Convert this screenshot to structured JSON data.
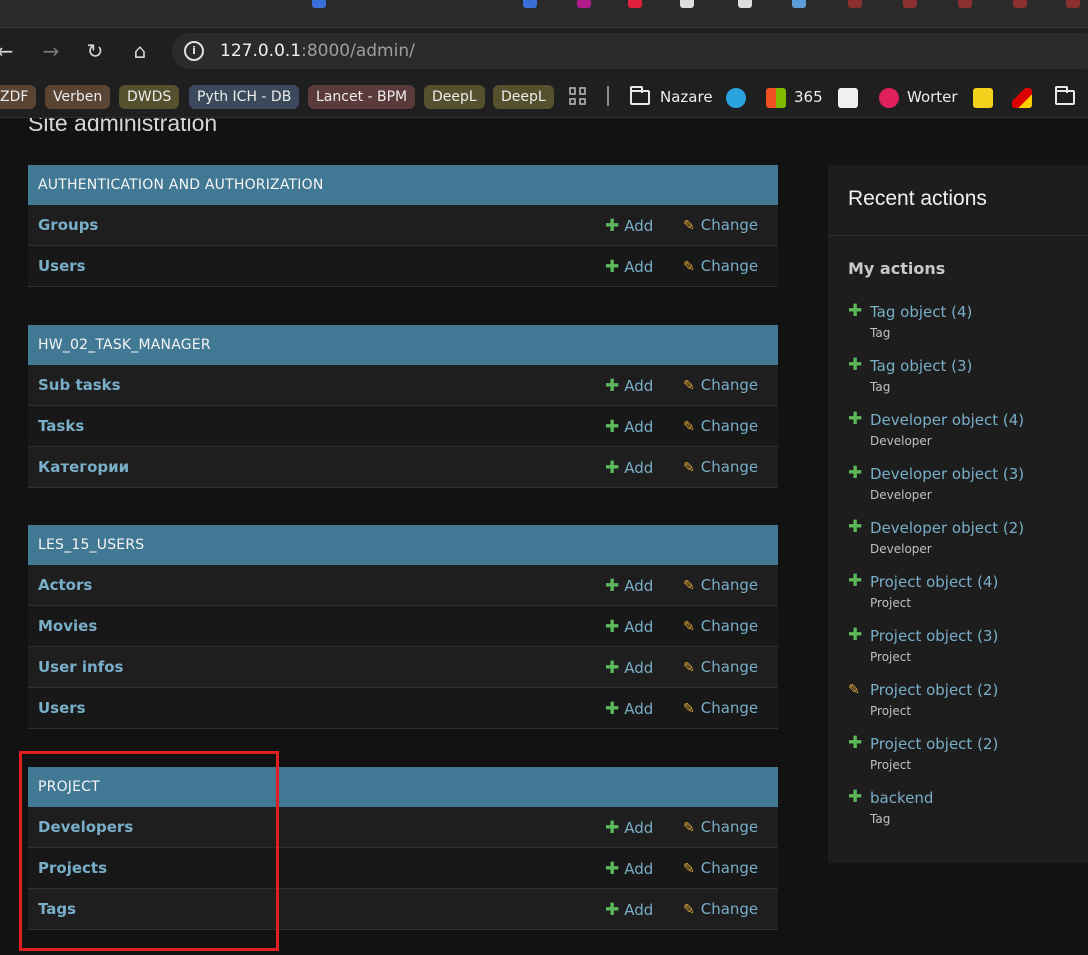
{
  "browser": {
    "url_host": "127.0.0.1",
    "url_rest": ":8000/admin/",
    "bookmarks": [
      {
        "label": "ZDF",
        "color": "#5a4535"
      },
      {
        "label": "Verben",
        "color": "#5a4535"
      },
      {
        "label": "DWDS",
        "color": "#55502e"
      },
      {
        "label": "Pyth ICH - DB",
        "color": "#3a4a5a"
      },
      {
        "label": "Lancet - BPM",
        "color": "#5a3a3a"
      },
      {
        "label": "DeepL",
        "color": "#55502e"
      },
      {
        "label": "DeepL",
        "color": "#55502e"
      }
    ],
    "bookmark_folders": [
      "Nazare",
      "365",
      "Worter"
    ]
  },
  "page": {
    "title": "Site administration"
  },
  "modules": [
    {
      "caption": "AUTHENTICATION AND AUTHORIZATION",
      "rows": [
        {
          "name": "Groups",
          "add": "Add",
          "change": "Change"
        },
        {
          "name": "Users",
          "add": "Add",
          "change": "Change"
        }
      ]
    },
    {
      "caption": "HW_02_TASK_MANAGER",
      "rows": [
        {
          "name": "Sub tasks",
          "add": "Add",
          "change": "Change"
        },
        {
          "name": "Tasks",
          "add": "Add",
          "change": "Change"
        },
        {
          "name": "Категории",
          "add": "Add",
          "change": "Change"
        }
      ]
    },
    {
      "caption": "LES_15_USERS",
      "rows": [
        {
          "name": "Actors",
          "add": "Add",
          "change": "Change"
        },
        {
          "name": "Movies",
          "add": "Add",
          "change": "Change"
        },
        {
          "name": "User infos",
          "add": "Add",
          "change": "Change"
        },
        {
          "name": "Users",
          "add": "Add",
          "change": "Change"
        }
      ]
    },
    {
      "caption": "PROJECT",
      "rows": [
        {
          "name": "Developers",
          "add": "Add",
          "change": "Change"
        },
        {
          "name": "Projects",
          "add": "Add",
          "change": "Change"
        },
        {
          "name": "Tags",
          "add": "Add",
          "change": "Change"
        }
      ]
    }
  ],
  "recent": {
    "title": "Recent actions",
    "subtitle": "My actions",
    "actions": [
      {
        "icon": "add",
        "label": "Tag object (4)",
        "type": "Tag"
      },
      {
        "icon": "add",
        "label": "Tag object (3)",
        "type": "Tag"
      },
      {
        "icon": "add",
        "label": "Developer object (4)",
        "type": "Developer"
      },
      {
        "icon": "add",
        "label": "Developer object (3)",
        "type": "Developer"
      },
      {
        "icon": "add",
        "label": "Developer object (2)",
        "type": "Developer"
      },
      {
        "icon": "add",
        "label": "Project object (4)",
        "type": "Project"
      },
      {
        "icon": "add",
        "label": "Project object (3)",
        "type": "Project"
      },
      {
        "icon": "change",
        "label": "Project object (2)",
        "type": "Project"
      },
      {
        "icon": "add",
        "label": "Project object (2)",
        "type": "Project"
      },
      {
        "icon": "add",
        "label": "backend",
        "type": "Tag"
      }
    ]
  },
  "colors": {
    "caption_bg": "#417893",
    "link": "#79aec8",
    "add_icon": "#5bb85b",
    "change_icon": "#e0a73a",
    "highlight": "#e02020"
  }
}
